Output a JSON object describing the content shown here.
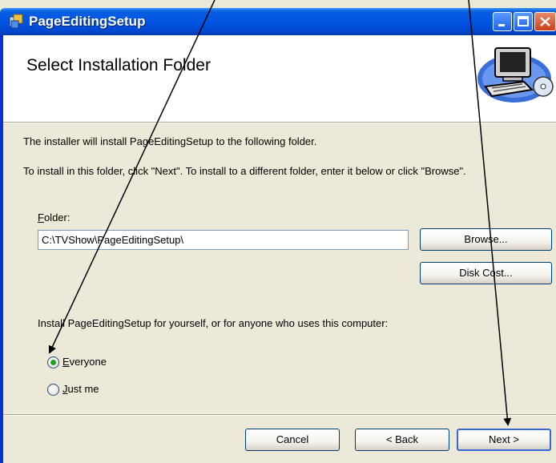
{
  "window": {
    "title": "PageEditingSetup"
  },
  "header": {
    "title": "Select Installation Folder"
  },
  "body": {
    "intro": "The installer will install PageEditingSetup to the following folder.",
    "instructions": "To install in this folder, click \"Next\". To install to a different folder, enter it below or click \"Browse\".",
    "folder_label_first": "F",
    "folder_label_rest": "older:",
    "folder_value": "C:\\TVShow\\PageEditingSetup\\",
    "browse_label": "Browse...",
    "disk_cost_label": "Disk Cost...",
    "install_for_prompt": "Install PageEditingSetup for yourself, or for anyone who uses this computer:",
    "options": [
      {
        "first": "E",
        "rest": "veryone",
        "selected": true
      },
      {
        "first": "J",
        "rest": "ust me",
        "selected": false
      }
    ]
  },
  "footer": {
    "cancel_label": "Cancel",
    "back_label": "< Back",
    "next_label": "Next >"
  },
  "colors": {
    "titlebar": "#0054e3",
    "dialog_bg": "#ece9d8",
    "radio_selected": "#21a121"
  },
  "icons": [
    "installer-app-icon",
    "minimize-icon",
    "maximize-icon",
    "close-icon",
    "computer-cd-icon"
  ]
}
